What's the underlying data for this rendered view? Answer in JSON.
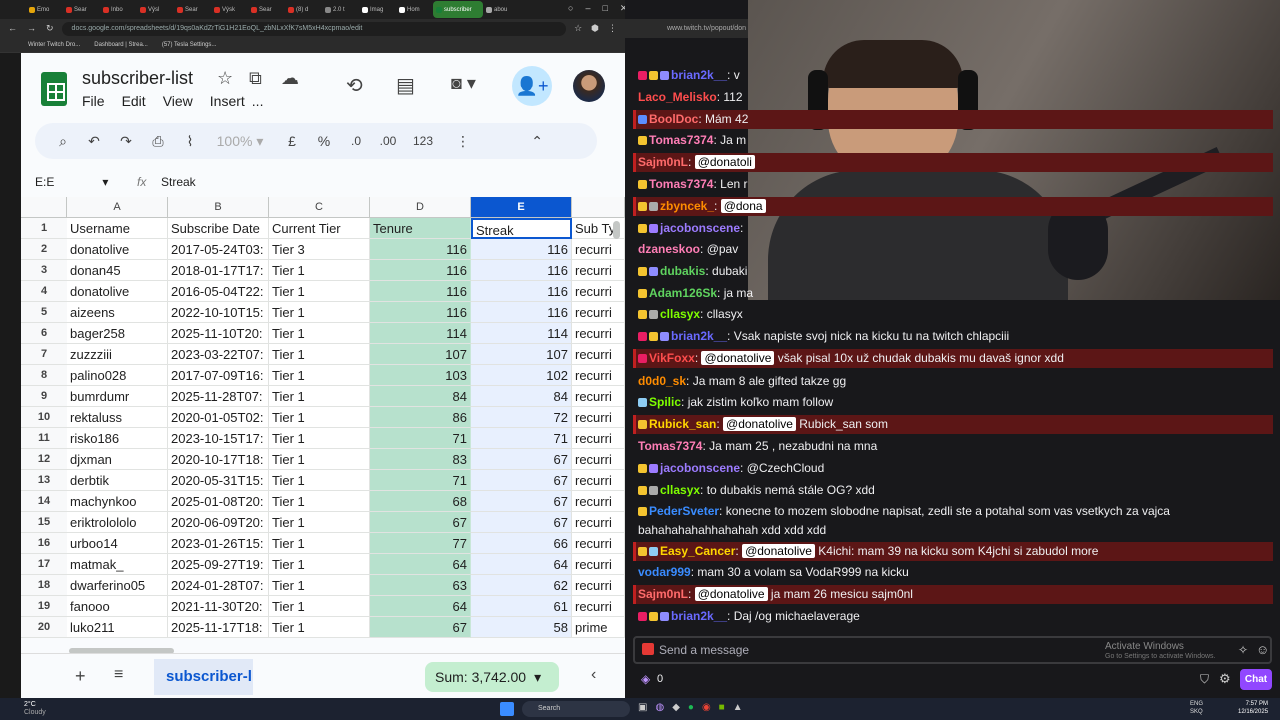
{
  "browser": {
    "tabs": [
      {
        "label": "Emo",
        "color": "#e5a50a"
      },
      {
        "label": "Sear",
        "color": "#d93025"
      },
      {
        "label": "Inbo",
        "color": "#d93025"
      },
      {
        "label": "Výsl",
        "color": "#d93025"
      },
      {
        "label": "Sear",
        "color": "#d93025"
      },
      {
        "label": "Výsk",
        "color": "#d93025"
      },
      {
        "label": "Sear",
        "color": "#d93025"
      },
      {
        "label": "(8) d",
        "color": "#d93025"
      },
      {
        "label": "2.0 t",
        "color": "#888"
      },
      {
        "label": "Imag",
        "color": "#fff"
      },
      {
        "label": "Hom",
        "color": "#fff"
      },
      {
        "label": "subscriber",
        "color": "#188038"
      },
      {
        "label": "abou",
        "color": "#aaa"
      }
    ],
    "url": "docs.google.com/spreadsheets/d/19qs0aKdZrTiG1H21EoQL_zbNLxXfK7sM5xH4xcpmao/edit",
    "bookmarks": [
      "Winter Twitch Dro...",
      "Dashboard | Strea...",
      "(57) Tesla Settings..."
    ],
    "twitch_url": "www.twitch.tv/popout/don"
  },
  "sheets": {
    "title": "subscriber-list",
    "menus": [
      "File",
      "Edit",
      "View",
      "Insert",
      "..."
    ],
    "zoom": "100%",
    "currency": "£",
    "percent": "%",
    "dec_less": ".0",
    "dec_more": ".00",
    "format": "123",
    "namebox": "E:E",
    "fx": "fx",
    "formula": "Streak",
    "col_letters": [
      "A",
      "B",
      "C",
      "D",
      "E"
    ],
    "headers": [
      "Username",
      "Subscribe Date",
      "Current Tier",
      "Tenure",
      "Streak",
      "Sub Ty"
    ],
    "rows": [
      [
        "2",
        "donatolive",
        "2017-05-24T03:",
        "Tier 3",
        "116",
        "116",
        "recurri"
      ],
      [
        "3",
        "donan45",
        "2018-01-17T17:",
        "Tier 1",
        "116",
        "116",
        "recurri"
      ],
      [
        "4",
        "donatolive",
        "2016-05-04T22:",
        "Tier 1",
        "116",
        "116",
        "recurri"
      ],
      [
        "5",
        "aizeens",
        "2022-10-10T15:",
        "Tier 1",
        "116",
        "116",
        "recurri"
      ],
      [
        "6",
        "bager258",
        "2025-11-10T20:",
        "Tier 1",
        "114",
        "114",
        "recurri"
      ],
      [
        "7",
        "zuzzziii",
        "2023-03-22T07:",
        "Tier 1",
        "107",
        "107",
        "recurri"
      ],
      [
        "8",
        "palino028",
        "2017-07-09T16:",
        "Tier 1",
        "103",
        "102",
        "recurri"
      ],
      [
        "9",
        "bumrdumr",
        "2025-11-28T07:",
        "Tier 1",
        "84",
        "84",
        "recurri"
      ],
      [
        "10",
        "rektaluss",
        "2020-01-05T02:",
        "Tier 1",
        "86",
        "72",
        "recurri"
      ],
      [
        "11",
        "risko186",
        "2023-10-15T17:",
        "Tier 1",
        "71",
        "71",
        "recurri"
      ],
      [
        "12",
        "djxman",
        "2020-10-17T18:",
        "Tier 1",
        "83",
        "67",
        "recurri"
      ],
      [
        "13",
        "derbtik",
        "2020-05-31T15:",
        "Tier 1",
        "71",
        "67",
        "recurri"
      ],
      [
        "14",
        "machynkoo",
        "2025-01-08T20:",
        "Tier 1",
        "68",
        "67",
        "recurri"
      ],
      [
        "15",
        "eriktrolololo",
        "2020-06-09T20:",
        "Tier 1",
        "67",
        "67",
        "recurri"
      ],
      [
        "16",
        "urboo14",
        "2023-01-26T15:",
        "Tier 1",
        "77",
        "66",
        "recurri"
      ],
      [
        "17",
        "matmak_",
        "2025-09-27T19:",
        "Tier 1",
        "64",
        "64",
        "recurri"
      ],
      [
        "18",
        "dwarferino05",
        "2024-01-28T07:",
        "Tier 1",
        "63",
        "62",
        "recurri"
      ],
      [
        "19",
        "fanooo",
        "2021-11-30T20:",
        "Tier 1",
        "64",
        "61",
        "recurri"
      ],
      [
        "20",
        "luko211",
        "2025-11-17T18:",
        "Tier 1",
        "67",
        "58",
        "prime"
      ]
    ],
    "sheet_tab": "subscriber-l",
    "sum": "Sum: 3,742.00"
  },
  "chat": {
    "messages": [
      {
        "user": "brian2k__",
        "color": "#6a6aff",
        "text": "v",
        "hl": false,
        "badges": [
          "#e91e63",
          "#f4c430",
          "#8e8cff"
        ]
      },
      {
        "user": "Laco_Melisko",
        "color": "#ff4d4d",
        "text": "112",
        "hl": false,
        "badges": []
      },
      {
        "user": "BoolDoc",
        "color": "#ff6b6b",
        "text": "Mám 42",
        "hl": true,
        "badges": [
          "#5c8eff"
        ]
      },
      {
        "user": "Tomas7374",
        "color": "#ff7eb6",
        "text": "Ja m",
        "hl": false,
        "badges": [
          "#f4c430"
        ]
      },
      {
        "user": "Sajm0nL",
        "color": "#ff6b6b",
        "text": "",
        "mention": "@donatoli",
        "hl": true,
        "badges": []
      },
      {
        "user": "Tomas7374",
        "color": "#ff7eb6",
        "text": "Len r",
        "hl": false,
        "badges": [
          "#f4c430"
        ]
      },
      {
        "user": "zbyncek_",
        "color": "#ff8c00",
        "text": "",
        "mention": "@dona",
        "hl": true,
        "badges": [
          "#f4c430",
          "#aaa"
        ]
      },
      {
        "user": "jacobonscene",
        "color": "#9c7bff",
        "text": "",
        "hl": false,
        "badges": [
          "#f4c430",
          "#9c7bff"
        ]
      },
      {
        "user": "dzaneskoo",
        "color": "#ff7eb6",
        "text": "@pav",
        "hl": false,
        "badges": []
      },
      {
        "user": "dubakis",
        "color": "#5fd35f",
        "text": "dubaki",
        "hl": false,
        "badges": [
          "#f4c430",
          "#8e8cff"
        ]
      },
      {
        "user": "Adam126Sk",
        "color": "#5fd35f",
        "text": "ja ma",
        "hl": false,
        "badges": [
          "#f4c430"
        ]
      },
      {
        "user": "cllasyx",
        "color": "#7fff00",
        "text": "cllasyx",
        "hl": false,
        "badges": [
          "#f4c430",
          "#aaa"
        ]
      },
      {
        "user": "brian2k__",
        "color": "#6a6aff",
        "text": "Vsak napiste svoj nick na kicku tu na twitch chlapciii",
        "hl": false,
        "badges": [
          "#e91e63",
          "#f4c430",
          "#8e8cff"
        ]
      },
      {
        "user": "VikFoxx",
        "color": "#ff4d4d",
        "text": "však pisal 10x už chudak dubakis mu davaš ignor xdd",
        "mention": "@donatolive",
        "hl": true,
        "badges": [
          "#e91e63"
        ]
      },
      {
        "user": "d0d0_sk",
        "color": "#ff8c00",
        "text": "Ja mam 8 ale gifted takze gg",
        "hl": false,
        "badges": []
      },
      {
        "user": "Spilic",
        "color": "#7fff00",
        "text": "jak zistim koľko mam follow",
        "hl": false,
        "badges": [
          "#8ecdf4"
        ]
      },
      {
        "user": "Rubick_san",
        "color": "#ffd700",
        "text": "Rubick_san som",
        "mention": "@donatolive",
        "hl": true,
        "badges": [
          "#f4c430"
        ]
      },
      {
        "user": "Tomas7374",
        "color": "#ff7eb6",
        "text": "Ja mam 25 , nezabudni na mna",
        "hl": false,
        "badges": []
      },
      {
        "user": "jacobonscene",
        "color": "#9c7bff",
        "text": "@CzechCloud",
        "hl": false,
        "badges": [
          "#f4c430",
          "#9c7bff"
        ]
      },
      {
        "user": "cllasyx",
        "color": "#7fff00",
        "text": "to dubakis nemá stále OG? xdd",
        "hl": false,
        "badges": [
          "#f4c430",
          "#aaa"
        ]
      },
      {
        "user": "PederSveter",
        "color": "#3a8cff",
        "text": "konecne to mozem slobodne napisat, zedli ste a potahal som vas vsetkych za vajca bahahahahahhahahah xdd xdd xdd",
        "hl": false,
        "badges": [
          "#f4c430"
        ]
      },
      {
        "user": "Easy_Cancer",
        "color": "#ffd700",
        "text": "K4ichi: mam 39 na kicku som K4jchi",
        "mention": "@donatolive",
        "after": "si zabudol more",
        "hl": true,
        "badges": [
          "#f4c430",
          "#8ecdf4"
        ]
      },
      {
        "user": "vodar999",
        "color": "#3a8cff",
        "text": "mam 30 a volam sa VodaR999 na kicku",
        "hl": false,
        "badges": []
      },
      {
        "user": "Sajm0nL",
        "color": "#ff6b6b",
        "text": "ja mam 26 mesicu sajm0nl",
        "mention": "@donatolive",
        "hl": true,
        "badges": []
      },
      {
        "user": "brian2k__",
        "color": "#6a6aff",
        "text": "Daj /og michaelaverage",
        "hl": false,
        "badges": [
          "#e91e63",
          "#f4c430",
          "#8e8cff"
        ]
      }
    ],
    "placeholder": "Send a message",
    "activate_title": "Activate Windows",
    "activate_sub": "Go to Settings to activate Windows.",
    "points": "0",
    "chat_button": "Chat"
  },
  "taskbar": {
    "weather_temp": "2°C",
    "weather_desc": "Cloudy",
    "search": "Search",
    "lang1": "ENG",
    "lang2": "SKQ",
    "time": "7:57 PM",
    "date": "12/16/2025"
  }
}
